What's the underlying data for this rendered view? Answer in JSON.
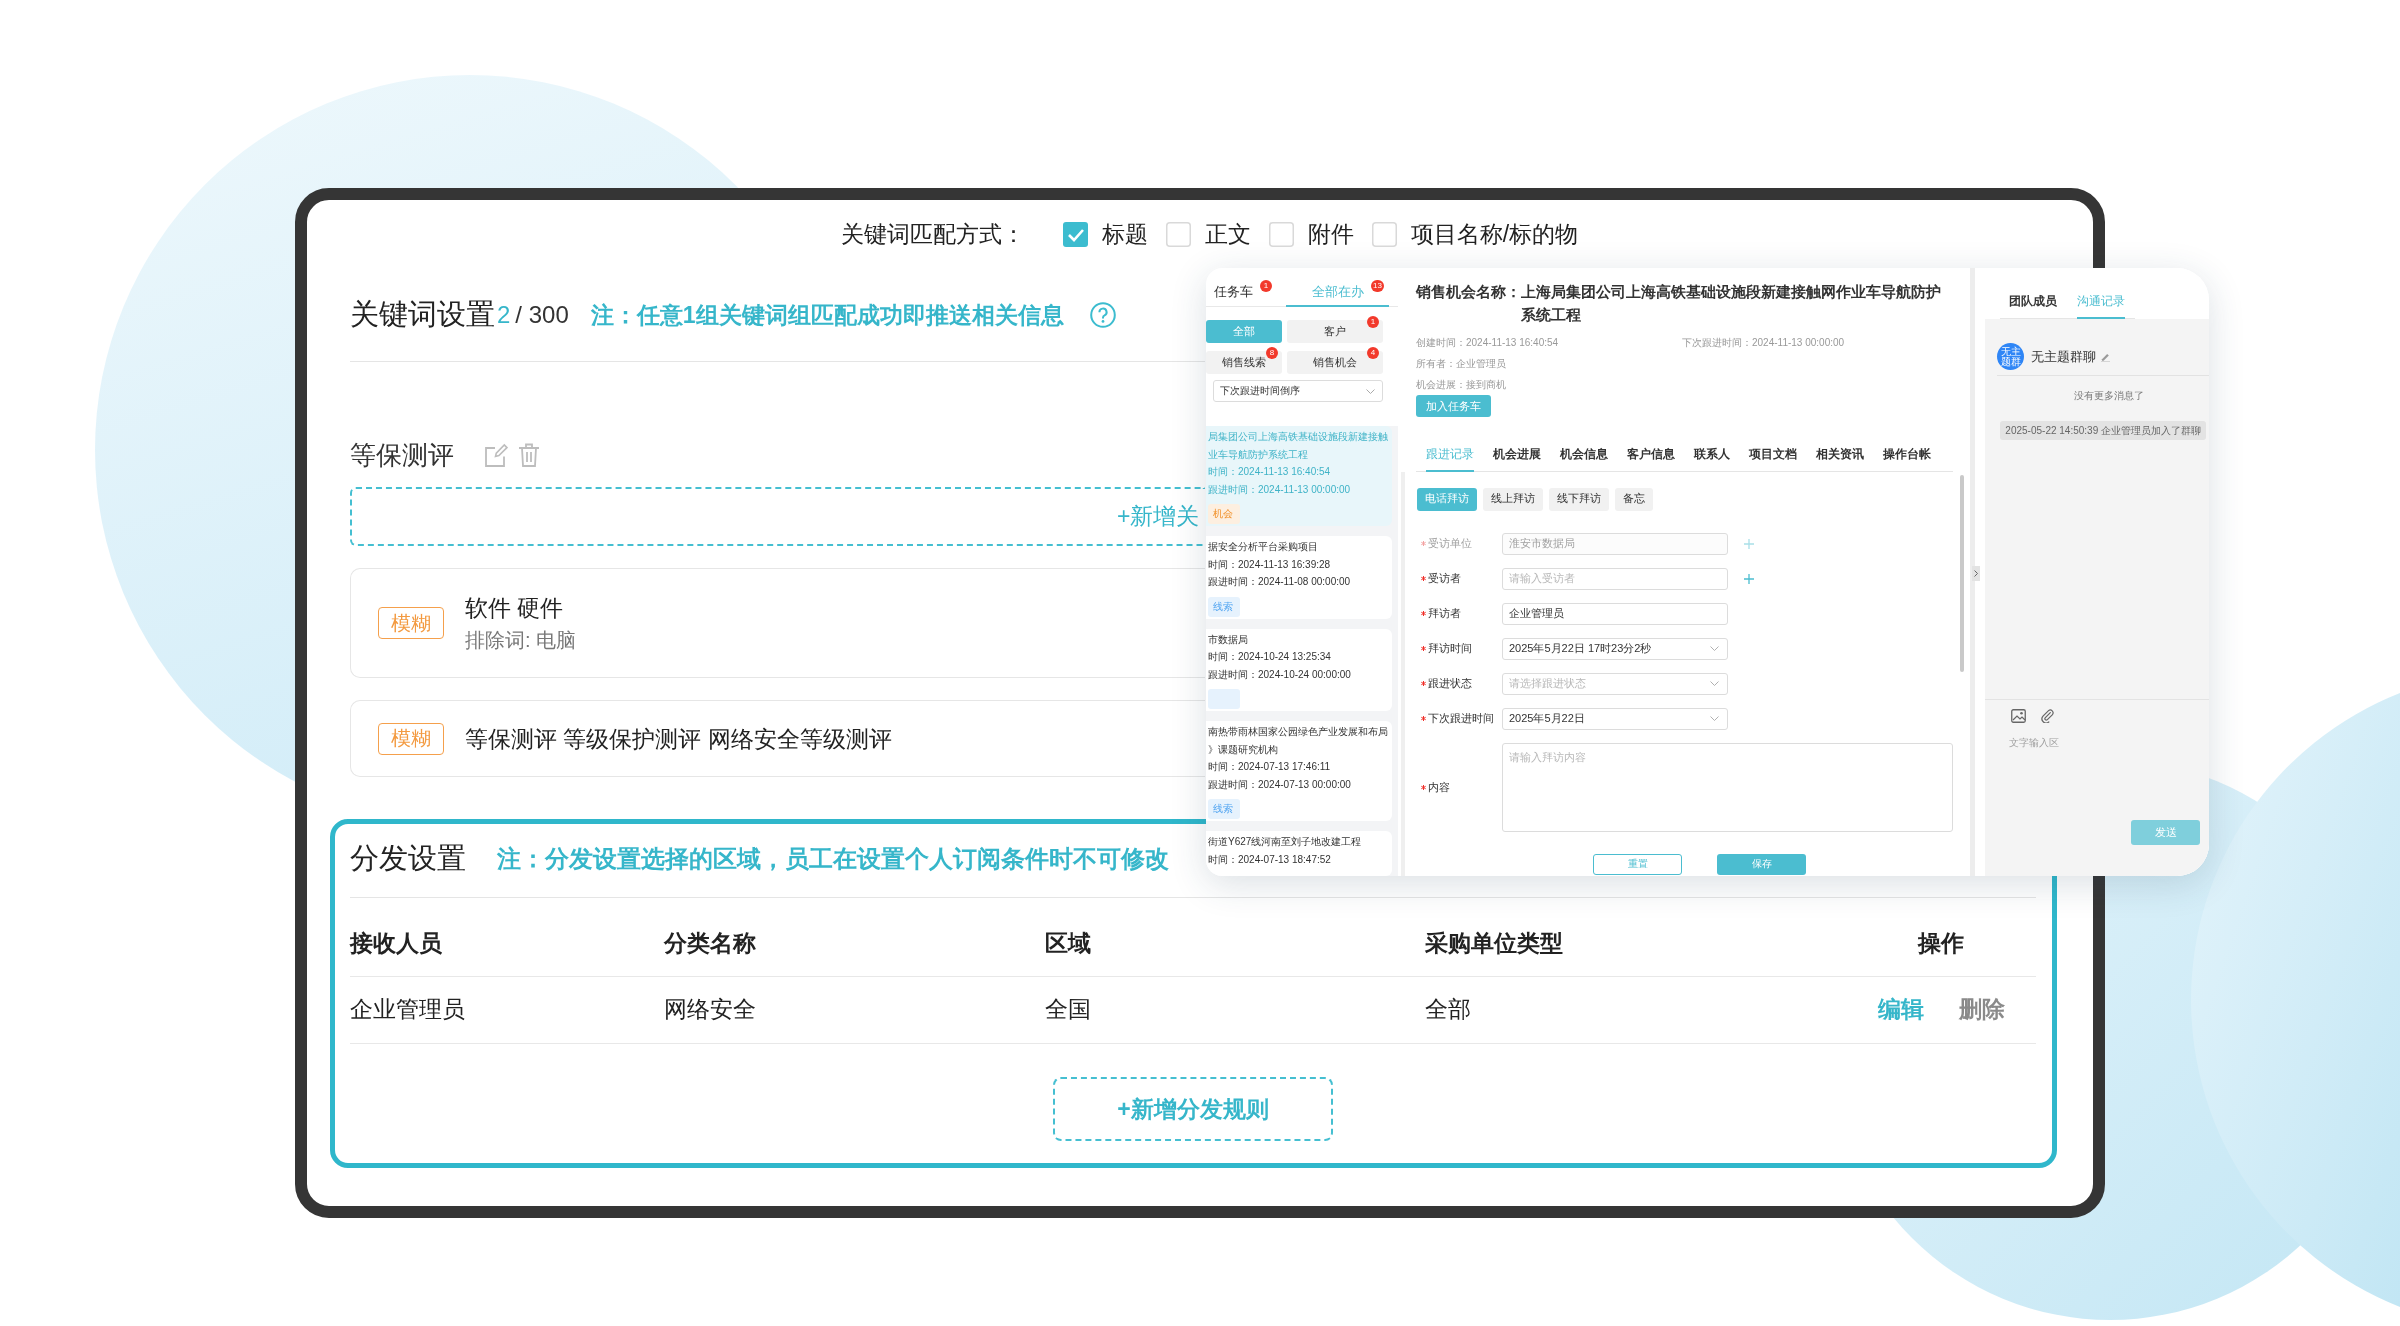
{
  "match_mode": {
    "label": "关键词匹配方式：",
    "options": [
      {
        "label": "标题",
        "checked": true
      },
      {
        "label": "正文",
        "checked": false
      },
      {
        "label": "附件",
        "checked": false
      },
      {
        "label": "项目名称/标的物",
        "checked": false
      }
    ]
  },
  "keyword_settings": {
    "title": "关键词设置",
    "count": "2",
    "limit": "/ 300",
    "note": "注：任意1组关键词组匹配成功即推送相关信息"
  },
  "keyword_group": {
    "name": "等保测评",
    "add_button": "+新增关",
    "items": [
      {
        "tag": "模糊",
        "keywords": "软件 硬件",
        "exclude": "排除词: 电脑"
      },
      {
        "tag": "模糊",
        "keywords": "等保测评 等级保护测评 网络安全等级测评"
      }
    ]
  },
  "distribution": {
    "title": "分发设置",
    "note": "注：分发设置选择的区域，员工在设置个人订阅条件时不可修改",
    "columns": [
      "接收人员",
      "分类名称",
      "区域",
      "采购单位类型",
      "操作"
    ],
    "rows": [
      {
        "cells": [
          "企业管理员",
          "网络安全",
          "全国",
          "全部"
        ],
        "actions": [
          {
            "label": "编辑",
            "kind": "edit"
          },
          {
            "label": "删除",
            "kind": "delete"
          }
        ]
      }
    ],
    "add_button": "+新增分发规则"
  },
  "overlay": {
    "task_panel": {
      "tabs": [
        {
          "label": "任务车",
          "badge": "1",
          "selected": false
        },
        {
          "label": "全部在办",
          "badge": "13",
          "selected": true
        }
      ],
      "filters": [
        {
          "label": "全部",
          "selected": true
        },
        {
          "label": "客户",
          "badge": "1",
          "selected": false
        },
        {
          "label": "销售线索",
          "badge": "8",
          "selected": false
        },
        {
          "label": "销售机会",
          "badge": "4",
          "selected": false
        }
      ],
      "sort": "下次跟进时间倒序",
      "cards": [
        {
          "selected": true,
          "title_lines": [
            "局集团公司上海高铁基础设施段新建接触",
            "业车导航防护系统工程"
          ],
          "created": "时间：2024-11-13 16:40:54",
          "next": "跟进时间：2024-11-13 00:00:00",
          "tag": {
            "text": "机会",
            "color": "#fdefe0"
          }
        },
        {
          "selected": false,
          "title_lines": [
            "据安全分析平台采购项目"
          ],
          "created": "时间：2024-11-13 16:39:28",
          "next": "跟进时间：2024-11-08 00:00:00",
          "tag": {
            "text": "线索",
            "color": "#e6f2fd"
          }
        },
        {
          "selected": false,
          "title_lines": [
            "市数据局"
          ],
          "created": "时间：2024-10-24 13:25:34",
          "next": "跟进时间：2024-10-24 00:00:00",
          "tag": {
            "color": "#e6f2fd"
          }
        },
        {
          "selected": false,
          "title_lines": [
            "南热带雨林国家公园绿色产业发展和布局",
            "》课题研究机构"
          ],
          "created": "时间：2024-07-13 17:46:11",
          "next": "跟进时间：2024-07-13 00:00:00",
          "tag": {
            "text": "线索",
            "color": "#e6f2fd"
          }
        },
        {
          "selected": false,
          "title_lines": [
            "街道Y627线河南至刘子地改建工程"
          ],
          "created": "时间：2024-07-13 18:47:52"
        }
      ]
    },
    "detail": {
      "title_label": "销售机会名称：",
      "title": "上海局集团公司上海高铁基础设施段新建接触网作业车导航防护系统工程",
      "created": "创建时间：2024-11-13 16:40:54",
      "next_follow": "下次跟进时间：2024-11-13 00:00:00",
      "owner": "所有者：企业管理员",
      "progress": "机会进展：接到商机",
      "add_button": "加入任务车",
      "tabs": [
        {
          "label": "跟进记录",
          "selected": true
        },
        {
          "label": "机会进展",
          "selected": false
        },
        {
          "label": "机会信息",
          "selected": false
        },
        {
          "label": "客户信息",
          "selected": false
        },
        {
          "label": "联系人",
          "selected": false
        },
        {
          "label": "项目文档",
          "selected": false
        },
        {
          "label": "相关资讯",
          "selected": false
        },
        {
          "label": "操作台帐",
          "selected": false
        }
      ],
      "visit_types": [
        {
          "label": "电话拜访",
          "selected": true
        },
        {
          "label": "线上拜访",
          "selected": false
        },
        {
          "label": "线下拜访",
          "selected": false
        },
        {
          "label": "备忘",
          "selected": false
        }
      ],
      "form": [
        {
          "label": "受访单位",
          "kind": "text",
          "required": true,
          "disabled": true,
          "add": true,
          "value": "淮安市数据局"
        },
        {
          "label": "受访者",
          "kind": "text",
          "required": true,
          "disabled": false,
          "add": true,
          "placeholder": "请输入受访者"
        },
        {
          "label": "拜访者",
          "kind": "text",
          "required": true,
          "disabled": false,
          "add": false,
          "value": "企业管理员"
        },
        {
          "label": "拜访时间",
          "kind": "select",
          "required": true,
          "disabled": false,
          "add": false,
          "value": "2025年5月22日 17时23分2秒"
        },
        {
          "label": "跟进状态",
          "kind": "select",
          "required": true,
          "disabled": false,
          "add": false,
          "placeholder": "请选择跟进状态"
        },
        {
          "label": "下次跟进时间",
          "kind": "select",
          "required": true,
          "disabled": false,
          "add": false,
          "value": "2025年5月22日"
        },
        {
          "label": "内容",
          "kind": "textarea",
          "required": true,
          "disabled": false,
          "add": false,
          "placeholder": "请输入拜访内容"
        }
      ],
      "buttons": [
        {
          "label": "重置",
          "kind": "secondary"
        },
        {
          "label": "保存",
          "kind": "primary"
        }
      ]
    },
    "chat": {
      "tabs": [
        {
          "label": "团队成员",
          "selected": false
        },
        {
          "label": "沟通记录",
          "selected": true
        }
      ],
      "avatar": "无主题群",
      "group_name": "无主题群聊",
      "no_more": "没有更多消息了",
      "messages": [
        {
          "text": "2025-05-22 14:50:39 企业管理员加入了群聊"
        }
      ],
      "input_placeholder": "文字输入区",
      "send_button": "发送"
    }
  }
}
